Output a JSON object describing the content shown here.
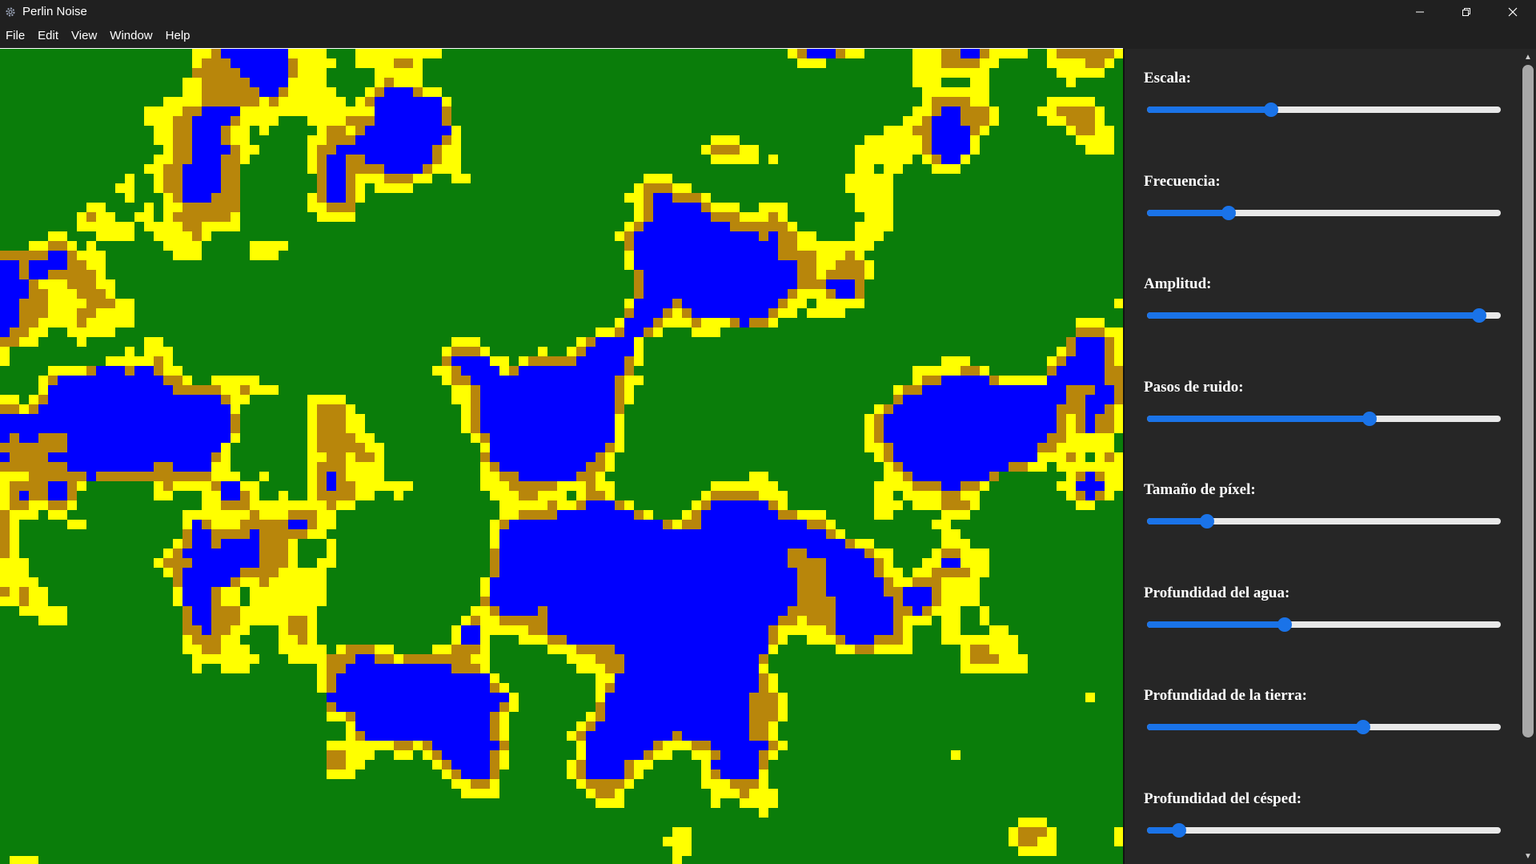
{
  "window": {
    "title": "Perlin Noise",
    "app_icon": "gear-icon"
  },
  "menu": {
    "items": [
      "File",
      "Edit",
      "View",
      "Window",
      "Help"
    ]
  },
  "colors": {
    "water": "#0000ff",
    "deep_sand": "#b8860b",
    "sand": "#ffff00",
    "grass": "#0a7d0a",
    "slider_accent": "#1a73e8"
  },
  "controls": [
    {
      "label": "Escala:",
      "value": 0.35
    },
    {
      "label": "Frecuencia:",
      "value": 0.23
    },
    {
      "label": "Amplitud:",
      "value": 0.94
    },
    {
      "label": "Pasos de ruido:",
      "value": 0.63
    },
    {
      "label": "Tamaño de píxel:",
      "value": 0.17
    },
    {
      "label": "Profundidad del agua:",
      "value": 0.39
    },
    {
      "label": "Profundidad de la tierra:",
      "value": 0.61
    },
    {
      "label": "Profundidad del césped:",
      "value": 0.09
    }
  ]
}
